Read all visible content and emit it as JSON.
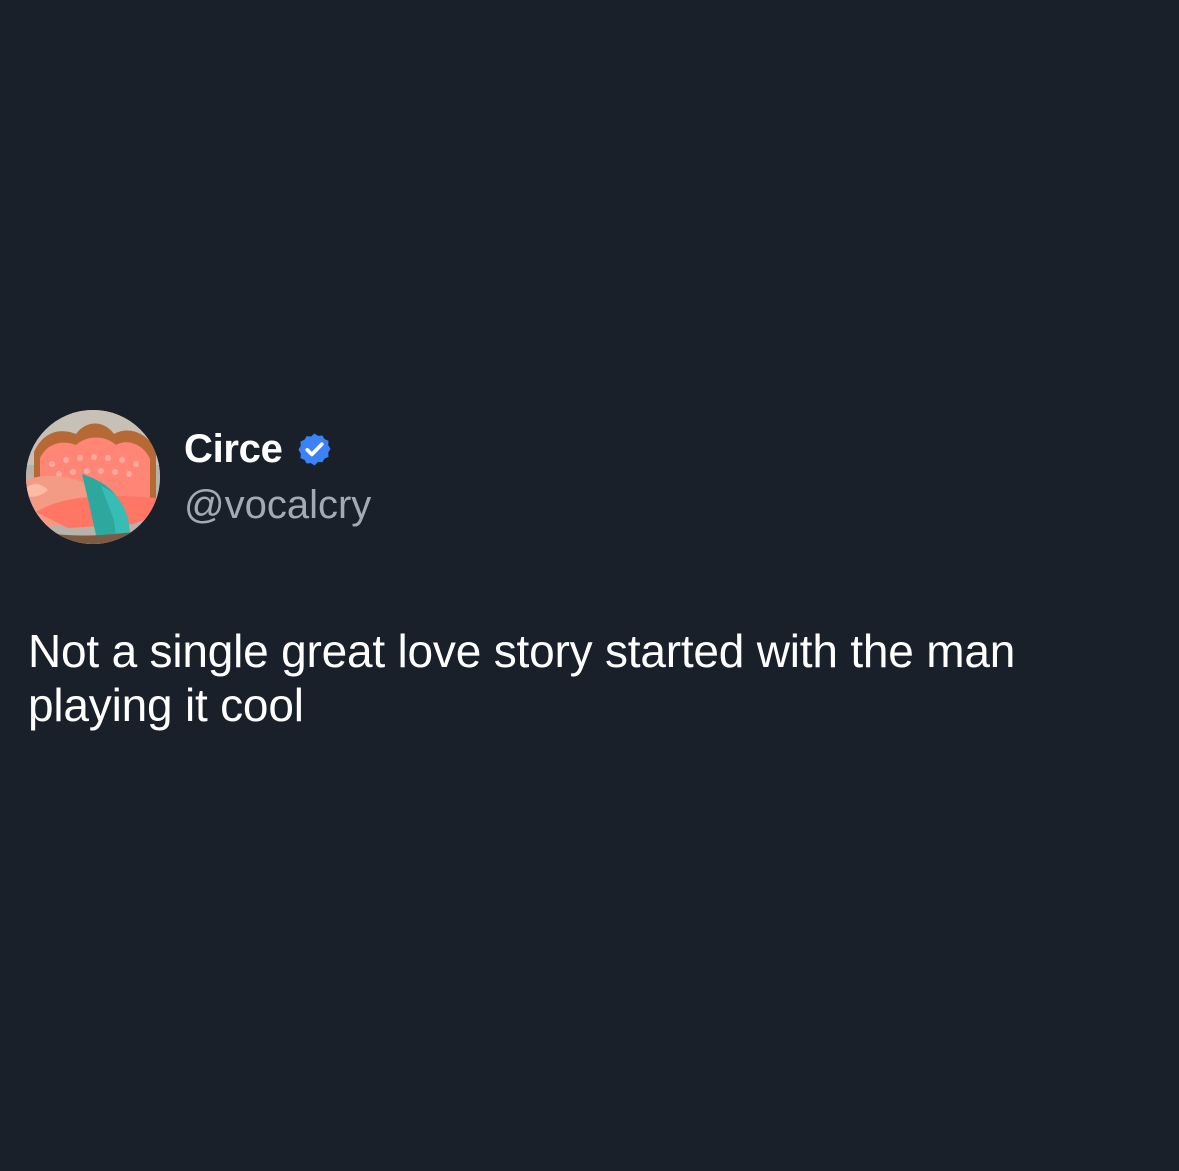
{
  "tweet": {
    "author": {
      "display_name": "Circe",
      "handle": "@vocalcry",
      "verified": true,
      "avatar_icon": "avatar-pink-sofa-image",
      "verified_icon": "verified-badge-icon"
    },
    "text": "Not a single great love story started with the man playing it cool"
  },
  "colors": {
    "background": "#19202a",
    "text_primary": "#ffffff",
    "text_secondary": "#a3aab3",
    "verified_badge": "#3b82f6"
  }
}
